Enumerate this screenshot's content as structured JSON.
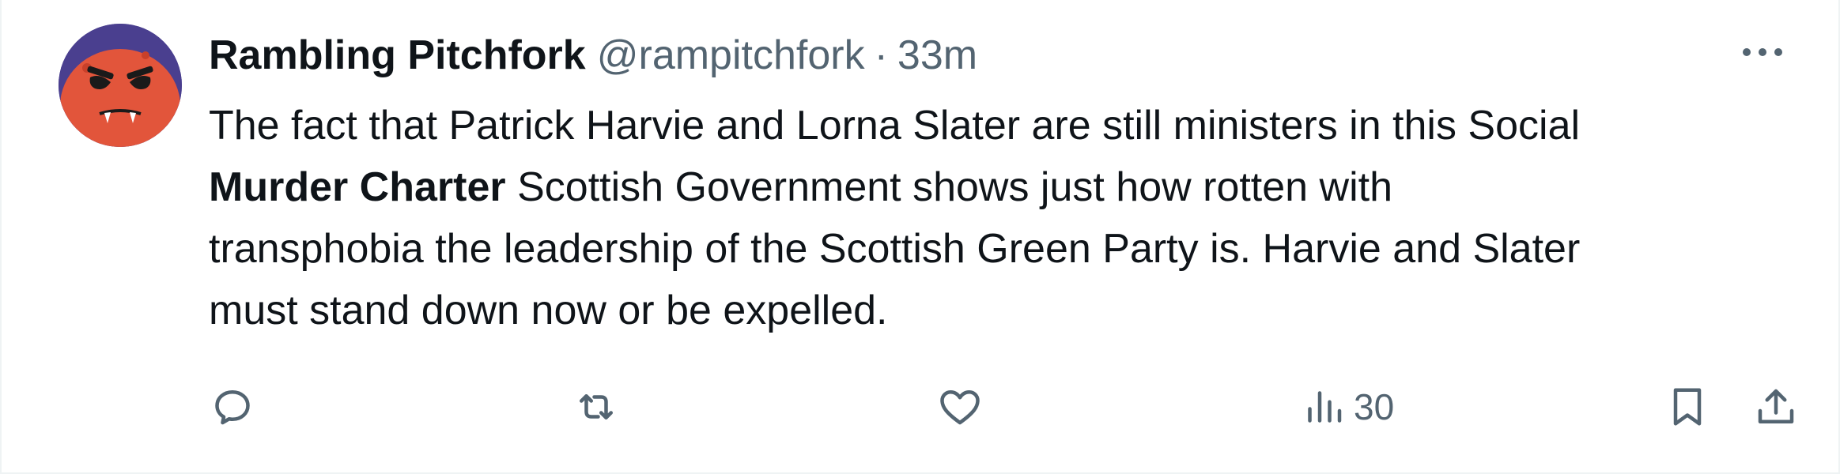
{
  "tweet": {
    "author_name": "Rambling Pitchfork",
    "handle": "@rampitchfork",
    "separator": "·",
    "time": "33m",
    "text": {
      "line1": "The fact that Patrick Harvie and Lorna Slater are still ministers in this Social",
      "bold": "Murder Charter",
      "line2_rest": " Scottish Government shows just how rotten with",
      "line3": "transphobia the leadership of the Scottish Green Party is. Harvie and Slater",
      "line4": "must stand down now or be expelled."
    }
  },
  "actions": {
    "views_count": "30"
  },
  "icons": {
    "avatar": "red-monster-avatar",
    "more": "more-icon",
    "reply": "reply-icon",
    "retweet": "retweet-icon",
    "like": "heart-icon",
    "views": "views-icon",
    "bookmark": "bookmark-icon",
    "share": "share-icon"
  },
  "colors": {
    "text": "#0f1419",
    "secondary": "#536471",
    "avatar_bg": "#4a3f8f",
    "avatar_face": "#e2553b"
  }
}
